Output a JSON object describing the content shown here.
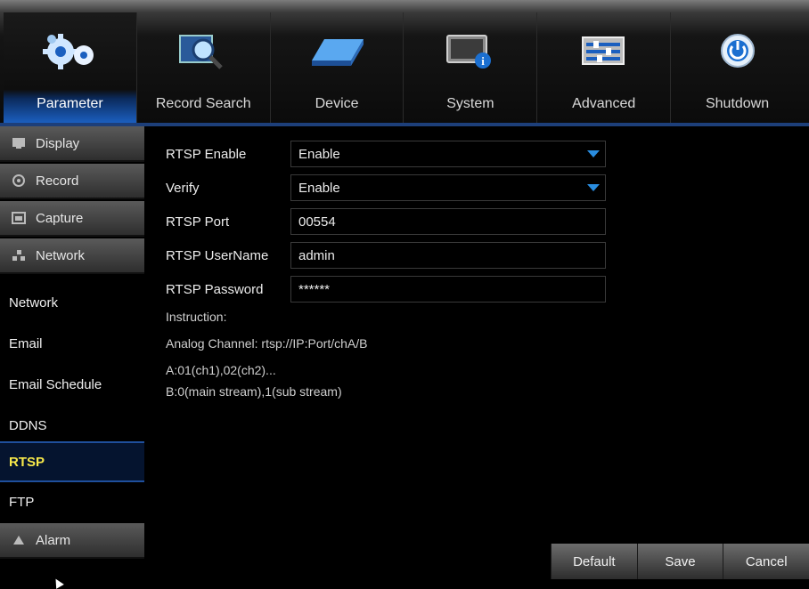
{
  "top_tabs": [
    {
      "label": "Parameter",
      "icon": "gears-icon",
      "active": true
    },
    {
      "label": "Record Search",
      "icon": "magnifier-icon"
    },
    {
      "label": "Device",
      "icon": "hard-drive-icon"
    },
    {
      "label": "System",
      "icon": "system-info-icon"
    },
    {
      "label": "Advanced",
      "icon": "sliders-icon"
    },
    {
      "label": "Shutdown",
      "icon": "power-icon"
    }
  ],
  "sidebar": {
    "categories": [
      {
        "label": "Display",
        "icon": "display-icon"
      },
      {
        "label": "Record",
        "icon": "record-icon"
      },
      {
        "label": "Capture",
        "icon": "capture-icon"
      },
      {
        "label": "Network",
        "icon": "network-icon"
      },
      {
        "label": "Alarm",
        "icon": "alarm-icon"
      }
    ],
    "network_items": [
      "Network",
      "Email",
      "Email Schedule",
      "DDNS",
      "RTSP",
      "FTP"
    ],
    "active_item": "RTSP"
  },
  "form": {
    "rtsp_enable": {
      "label": "RTSP Enable",
      "value": "Enable"
    },
    "verify": {
      "label": "Verify",
      "value": "Enable"
    },
    "rtsp_port": {
      "label": "RTSP Port",
      "value": "00554"
    },
    "rtsp_username": {
      "label": "RTSP UserName",
      "value": "admin"
    },
    "rtsp_password": {
      "label": "RTSP Password",
      "value": "******"
    }
  },
  "instructions": {
    "heading": "Instruction:",
    "lines": [
      "Analog Channel:  rtsp://IP:Port/chA/B",
      "A:01(ch1),02(ch2)...",
      "B:0(main stream),1(sub stream)"
    ]
  },
  "buttons": {
    "default": "Default",
    "save": "Save",
    "cancel": "Cancel"
  },
  "colors": {
    "accent_blue": "#1b5fbf",
    "active_text": "#f7e84a",
    "dropdown_arrow": "#2a8de0"
  }
}
